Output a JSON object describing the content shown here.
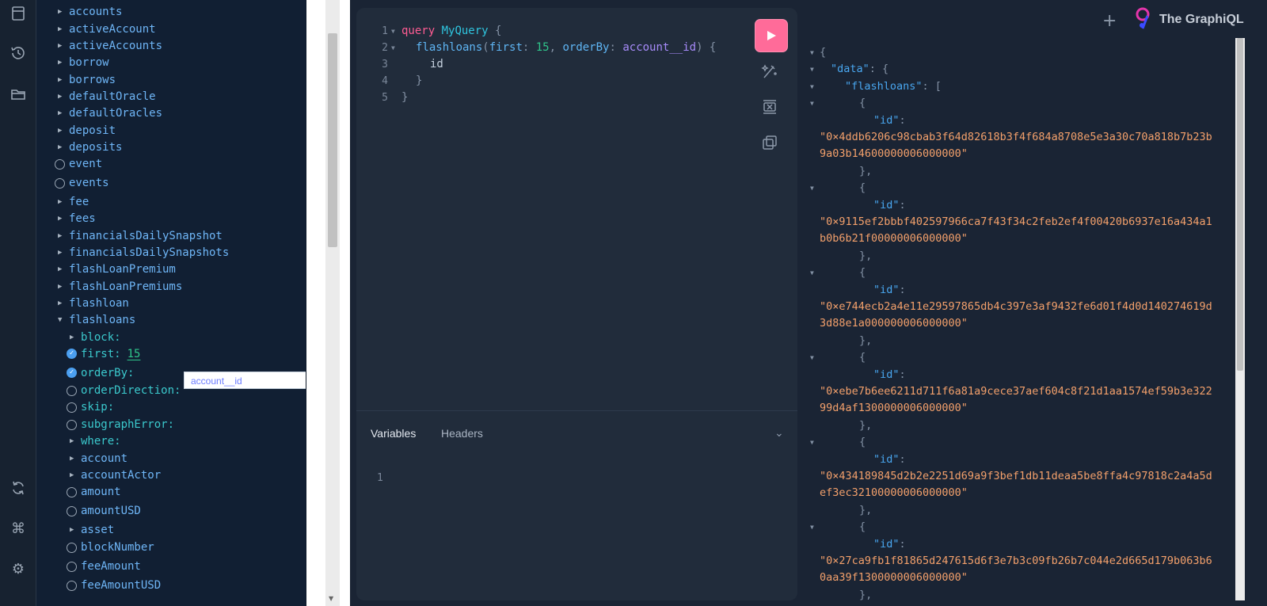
{
  "app": {
    "brand": "The GraphiQL"
  },
  "explorer": {
    "items": [
      {
        "label": "accounts",
        "kind": "arrow"
      },
      {
        "label": "activeAccount",
        "kind": "arrow"
      },
      {
        "label": "activeAccounts",
        "kind": "arrow"
      },
      {
        "label": "borrow",
        "kind": "arrow"
      },
      {
        "label": "borrows",
        "kind": "arrow"
      },
      {
        "label": "defaultOracle",
        "kind": "arrow"
      },
      {
        "label": "defaultOracles",
        "kind": "arrow"
      },
      {
        "label": "deposit",
        "kind": "arrow"
      },
      {
        "label": "deposits",
        "kind": "arrow"
      },
      {
        "label": "event",
        "kind": "circle"
      },
      {
        "label": "events",
        "kind": "circle"
      },
      {
        "label": "fee",
        "kind": "arrow"
      },
      {
        "label": "fees",
        "kind": "arrow"
      },
      {
        "label": "financialsDailySnapshot",
        "kind": "arrow"
      },
      {
        "label": "financialsDailySnapshots",
        "kind": "arrow"
      },
      {
        "label": "flashLoanPremium",
        "kind": "arrow"
      },
      {
        "label": "flashLoanPremiums",
        "kind": "arrow"
      },
      {
        "label": "flashloan",
        "kind": "arrow"
      },
      {
        "label": "flashloans",
        "kind": "open"
      }
    ],
    "args": [
      {
        "label": "block:",
        "kind": "arrow"
      },
      {
        "label": "first:",
        "kind": "check",
        "value": "15"
      },
      {
        "label": "orderBy:",
        "kind": "check"
      },
      {
        "label": "orderDirection:",
        "kind": "circle"
      },
      {
        "label": "skip:",
        "kind": "circle"
      },
      {
        "label": "subgraphError:",
        "kind": "circle"
      },
      {
        "label": "where:",
        "kind": "arrow"
      }
    ],
    "fields": [
      {
        "label": "account",
        "kind": "arrow"
      },
      {
        "label": "accountActor",
        "kind": "arrow"
      },
      {
        "label": "amount",
        "kind": "circle"
      },
      {
        "label": "amountUSD",
        "kind": "circle"
      },
      {
        "label": "asset",
        "kind": "arrow"
      },
      {
        "label": "blockNumber",
        "kind": "circle"
      },
      {
        "label": "feeAmount",
        "kind": "circle"
      },
      {
        "label": "feeAmountUSD",
        "kind": "circle"
      }
    ],
    "orderBy_value": "account__id"
  },
  "editor": {
    "line_numbers": [
      "1",
      "2",
      "3",
      "4",
      "5"
    ],
    "kw_query": "query",
    "op_name": "MyQuery",
    "brace_open": "{",
    "field_flashloans": "flashloans",
    "arg_first": "first",
    "arg_first_value": "15",
    "arg_orderBy": "orderBy",
    "arg_orderBy_value": "account__id",
    "field_id": "id",
    "brace_close": "}"
  },
  "variables": {
    "tab_variables": "Variables",
    "tab_headers": "Headers",
    "line_number": "1"
  },
  "results": {
    "key_data": "\"data\"",
    "key_flashloans": "\"flashloans\"",
    "key_id": "\"id\"",
    "ids": [
      [
        "\"0×4ddb6206c98cbab3f64d82618b3f4f684a8708e5e3a30c70a818b7b23b",
        "9a03b14600000006000000\""
      ],
      [
        "\"0×9115ef2bbbf402597966ca7f43f34c2feb2ef4f00420b6937e16a434a1",
        "b0b6b21f00000006000000\""
      ],
      [
        "\"0×e744ecb2a4e11e29597865db4c397e3af9432fe6d01f4d0d140274619d",
        "3d88e1a000000006000000\""
      ],
      [
        "\"0×ebe7b6ee6211d711f6a81a9cece37aef604c8f21d1aa1574ef59b3e322",
        "99d4af1300000006000000\""
      ],
      [
        "\"0×434189845d2b2e2251d69a9f3bef1db11deaa5be8ffa4c97818c2a4a5d",
        "ef3ec32100000006000000\""
      ],
      [
        "\"0×27ca9fb1f81865d247615d6f3e7b3c09fb26b7c044e2d665d179b063b6",
        "0aa39f1300000006000000\""
      ]
    ]
  },
  "colors": {
    "accent": "#ff6b99",
    "field": "#6fb6f7",
    "string": "#f3a06b",
    "keyword": "#ff5c93"
  }
}
